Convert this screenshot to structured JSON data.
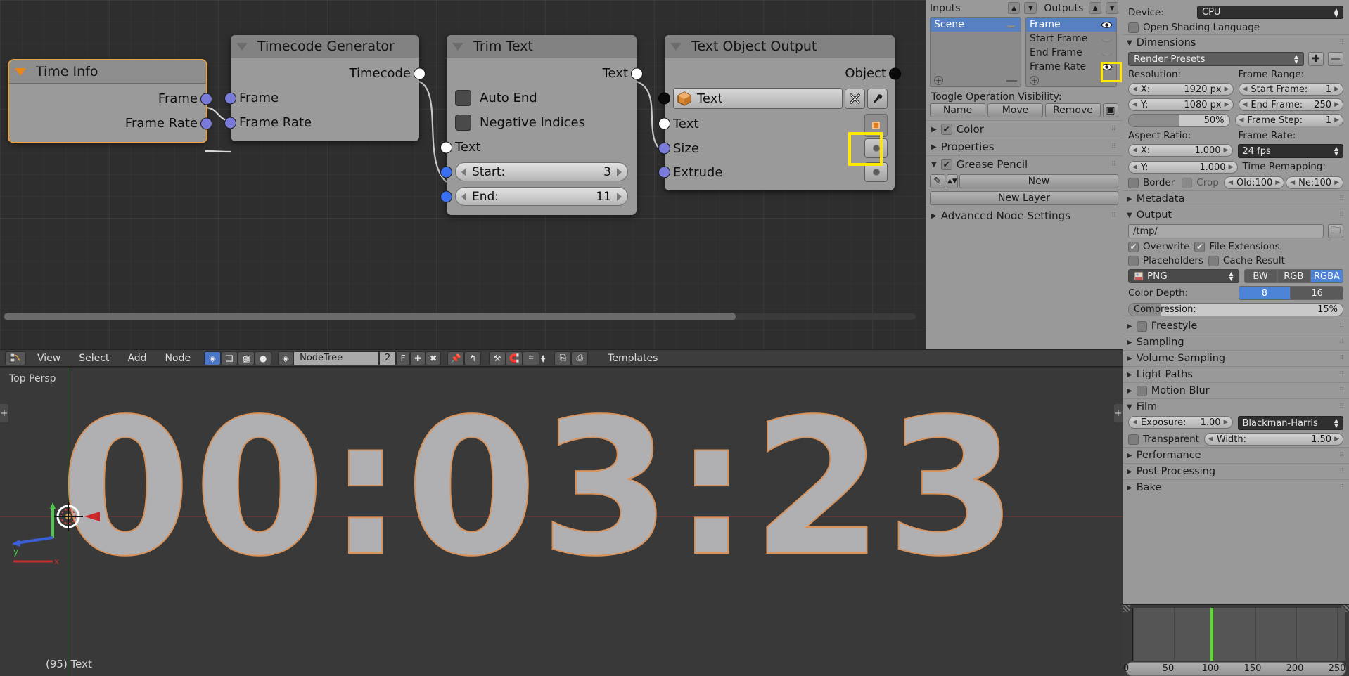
{
  "node_editor": {
    "nodes": [
      {
        "id": "time-info",
        "title": "Time Info",
        "selected": true,
        "outputs": [
          "Frame",
          "Frame Rate"
        ]
      },
      {
        "id": "timecode-generator",
        "title": "Timecode Generator",
        "selected": false,
        "outputs": [
          "Timecode"
        ],
        "inputs": [
          "Frame",
          "Frame Rate"
        ]
      },
      {
        "id": "trim-text",
        "title": "Trim Text",
        "selected": false,
        "outputs": [
          "Text"
        ],
        "checkboxes": [
          "Auto End",
          "Negative Indices"
        ],
        "input_label": "Text",
        "fields": [
          {
            "name": "Start:",
            "value": "3"
          },
          {
            "name": "End:",
            "value": "11"
          }
        ]
      },
      {
        "id": "text-object-output",
        "title": "Text Object Output",
        "selected": false,
        "outputs": [
          "Object"
        ],
        "object_field": {
          "icon": "object-cube-icon",
          "value": "Text"
        },
        "inputs": [
          "Text",
          "Size",
          "Extrude"
        ]
      }
    ]
  },
  "node_header": {
    "menus": [
      "View",
      "Select",
      "Add",
      "Node"
    ],
    "tree_type": "NodeTree",
    "tree_count": "2",
    "tree_fake_user": "F",
    "templates_label": "Templates"
  },
  "viewport": {
    "view_label": "Top Persp",
    "object_name": "(95) Text",
    "timecode_text": "00:03:23",
    "axis_x_label": "x",
    "axis_y_label": "y"
  },
  "n_panel": {
    "inputs_label": "Inputs",
    "outputs_label": "Outputs",
    "inputs_items": [
      {
        "label": "Scene",
        "selected": true,
        "visible": false
      }
    ],
    "outputs_items": [
      {
        "label": "Frame",
        "selected": true,
        "visible": true
      },
      {
        "label": "Start Frame",
        "selected": false,
        "visible": false
      },
      {
        "label": "End Frame",
        "selected": false,
        "visible": false
      },
      {
        "label": "Frame Rate",
        "selected": false,
        "visible": true,
        "highlighted": true
      }
    ],
    "toggle_label": "Toogle Operation Visibility:",
    "toggle_buttons": [
      "Name",
      "Move",
      "Remove"
    ],
    "sections": [
      {
        "label": "Color",
        "expanded": false,
        "checkbox": true,
        "checked": true
      },
      {
        "label": "Properties",
        "expanded": false,
        "checkbox": false
      },
      {
        "label": "Grease Pencil",
        "expanded": true,
        "checkbox": true,
        "checked": true
      },
      {
        "label": "Advanced Node Settings",
        "expanded": false,
        "checkbox": false
      }
    ],
    "grease_pencil": {
      "new_label": "New",
      "new_layer_label": "New Layer"
    }
  },
  "properties": {
    "device_label": "Device:",
    "device_value": "CPU",
    "open_shading_language": "Open Shading Language",
    "dimensions": {
      "title": "Dimensions",
      "render_presets": "Render Presets",
      "resolution_label": "Resolution:",
      "res_x_name": "X:",
      "res_x_value": "1920 px",
      "res_y_name": "Y:",
      "res_y_value": "1080 px",
      "res_percent": "50%",
      "frame_range_label": "Frame Range:",
      "start_frame_name": "Start Frame:",
      "start_frame_value": "1",
      "end_frame_name": "End Frame:",
      "end_frame_value": "250",
      "frame_step_name": "Frame Step:",
      "frame_step_value": "1",
      "aspect_label": "Aspect Ratio:",
      "aspect_x_name": "X:",
      "aspect_x_value": "1.000",
      "aspect_y_name": "Y:",
      "aspect_y_value": "1.000",
      "border_label": "Border",
      "crop_label": "Crop",
      "frame_rate_label": "Frame Rate:",
      "frame_rate_value": "24 fps",
      "time_remap_label": "Time Remapping:",
      "old_name": "Old:",
      "old_value": "100",
      "new_name": "Ne:",
      "new_value": "100"
    },
    "metadata_title": "Metadata",
    "output": {
      "title": "Output",
      "path": "/tmp/",
      "overwrite": "Overwrite",
      "overwrite_checked": true,
      "file_extensions": "File Extensions",
      "file_extensions_checked": true,
      "placeholders": "Placeholders",
      "placeholders_checked": false,
      "cache_result": "Cache Result",
      "cache_result_checked": false,
      "format": "PNG",
      "channels": [
        "BW",
        "RGB",
        "RGBA"
      ],
      "channels_selected": "RGBA",
      "color_depth_label": "Color Depth:",
      "color_depth_options": [
        "8",
        "16"
      ],
      "color_depth_selected": "8",
      "compression_label": "Compression:",
      "compression_value": "15%",
      "compression_percent": 15
    },
    "collapsed_sections": [
      {
        "label": "Freestyle",
        "checkbox": true
      },
      {
        "label": "Sampling",
        "checkbox": false
      },
      {
        "label": "Volume Sampling",
        "checkbox": false
      },
      {
        "label": "Light Paths",
        "checkbox": false
      },
      {
        "label": "Motion Blur",
        "checkbox": true
      }
    ],
    "film": {
      "title": "Film",
      "exposure_name": "Exposure:",
      "exposure_value": "1.00",
      "transparent_label": "Transparent",
      "filter_value": "Blackman-Harris",
      "width_name": "Width:",
      "width_value": "1.50"
    },
    "tail_sections": [
      {
        "label": "Performance"
      },
      {
        "label": "Post Processing"
      },
      {
        "label": "Bake"
      }
    ]
  },
  "timeline": {
    "ticks": [
      "0",
      "50",
      "100",
      "150",
      "200",
      "250"
    ],
    "range_start": 0,
    "range_end": 260,
    "playhead": 95
  },
  "colors": {
    "accent_blue": "#4e84d8",
    "selected_node": "#e8a243",
    "highlight_yellow": "#ffe800",
    "playhead_green": "#5ddb2e"
  }
}
